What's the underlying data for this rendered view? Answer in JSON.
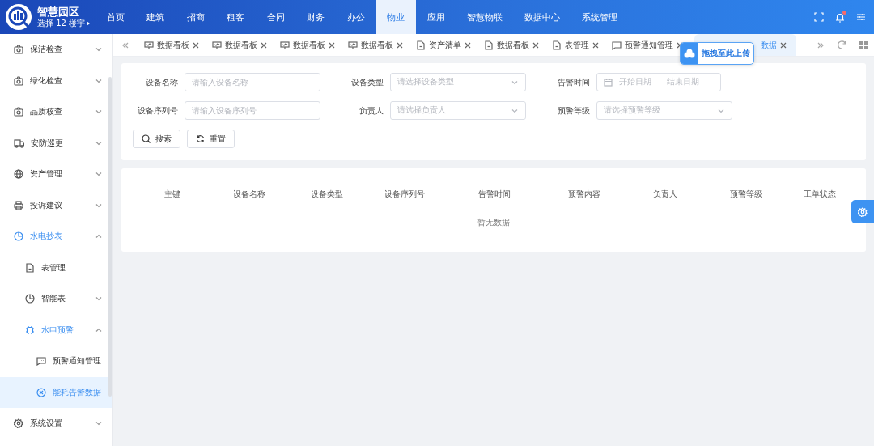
{
  "header": {
    "logo_title": "智慧园区",
    "building_selector": "选择 12 楼宇",
    "nav": [
      {
        "label": "首页",
        "selected": false
      },
      {
        "label": "建筑",
        "selected": false
      },
      {
        "label": "招商",
        "selected": false
      },
      {
        "label": "租客",
        "selected": false
      },
      {
        "label": "合同",
        "selected": false
      },
      {
        "label": "财务",
        "selected": false
      },
      {
        "label": "办公",
        "selected": false
      },
      {
        "label": "物业",
        "selected": true
      },
      {
        "label": "应用",
        "selected": false
      },
      {
        "label": "智慧物联",
        "selected": false
      },
      {
        "label": "数据中心",
        "selected": false
      },
      {
        "label": "系统管理",
        "selected": false
      }
    ],
    "notifications": {
      "unread": true
    }
  },
  "sidebar": {
    "items": [
      {
        "label": "保洁检查",
        "expanded": false,
        "selected": false
      },
      {
        "label": "绿化检查",
        "expanded": false,
        "selected": false
      },
      {
        "label": "品质核查",
        "expanded": false,
        "selected": false
      },
      {
        "label": "安防巡更",
        "expanded": false,
        "selected": false
      },
      {
        "label": "资产管理",
        "expanded": false,
        "selected": false
      },
      {
        "label": "投诉建议",
        "expanded": false,
        "selected": false
      },
      {
        "label": "水电抄表",
        "expanded": true,
        "selected": false,
        "children": [
          {
            "label": "表管理",
            "selected": false
          },
          {
            "label": "智能表",
            "expanded": false,
            "selected": false
          },
          {
            "label": "水电预警",
            "expanded": true,
            "selected": false,
            "children": [
              {
                "label": "预警通知管理",
                "selected": false
              },
              {
                "label": "能耗告警数据",
                "selected": true
              }
            ]
          }
        ]
      },
      {
        "label": "系统设置",
        "expanded": false,
        "selected": false
      }
    ]
  },
  "tabs": [
    {
      "label": "数据看板",
      "selected": false
    },
    {
      "label": "数据看板",
      "selected": false
    },
    {
      "label": "数据看板",
      "selected": false
    },
    {
      "label": "数据看板",
      "selected": false
    },
    {
      "label": "资产清单",
      "selected": false
    },
    {
      "label": "数据看板",
      "selected": false
    },
    {
      "label": "表管理",
      "selected": false
    },
    {
      "label": "预警通知管理",
      "selected": false
    },
    {
      "label": "数据",
      "selected": true
    }
  ],
  "upload_hint": "拖拽至此上传",
  "filters": [
    {
      "label": "设备名称",
      "kind": "input",
      "placeholder": "请输入设备名称"
    },
    {
      "label": "设备类型",
      "kind": "select",
      "placeholder": "请选择设备类型"
    },
    {
      "label": "告警时间",
      "kind": "daterange",
      "start_placeholder": "开始日期",
      "separator": "-",
      "end_placeholder": "结束日期"
    },
    {
      "label": "设备序列号",
      "kind": "input",
      "placeholder": "请输入设备序列号"
    },
    {
      "label": "负责人",
      "kind": "select",
      "placeholder": "请选择负责人"
    },
    {
      "label": "预警等级",
      "kind": "select",
      "placeholder": "请选择预警等级"
    }
  ],
  "buttons": [
    {
      "label": "搜索",
      "kind": "search"
    },
    {
      "label": "重置",
      "kind": "reset"
    }
  ],
  "table": {
    "columns": [
      "主键",
      "设备名称",
      "设备类型",
      "设备序列号",
      "告警时间",
      "预警内容",
      "负责人",
      "预警等级",
      "工单状态"
    ],
    "empty_text": "暂无数据"
  }
}
